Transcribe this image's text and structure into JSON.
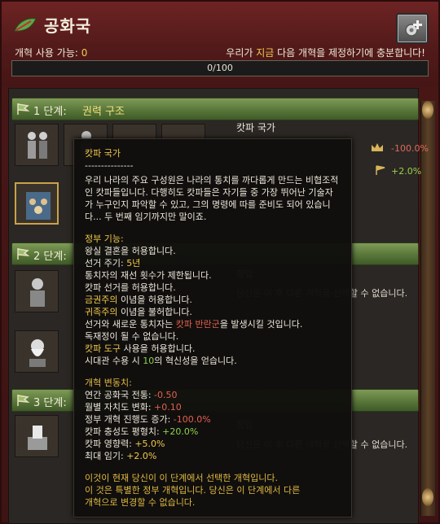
{
  "header": {
    "title": "공화국",
    "reform_available_label": "개혁 사용 가능: ",
    "reform_available_value": "0",
    "enough_msg_1": "우리가 ",
    "enough_msg_hl": "지금",
    "enough_msg_2": " 다음 개혁을 제정하기에 충분합니다!",
    "progress_text": "0/100",
    "progress_value": 0
  },
  "tiers": [
    {
      "num": "1 단계:",
      "name": "권력 구조"
    },
    {
      "num": "2 단계:",
      "name": ""
    },
    {
      "num": "3 단계:",
      "name": ""
    }
  ],
  "background": {
    "policy_name": "캇파 국가",
    "mod_red": "-100.0%",
    "mod_green": "+2.0%",
    "row2_title": "참입",
    "row2_text": "당신은 이 후 다른 개혁을 선택할 수 없습니다.",
    "row3_title": "참입",
    "row3_text": "당신은 이 후 다른 개혁을 선택할 수 없습니다."
  },
  "tooltip": {
    "title": "캇파 국가",
    "divider": "---------------",
    "description": "우리 나라의 주요 구성원은 나라의 통치를 까다롭게 만드는 비협조적인 캇파들입니다. 다행히도 캇파들은 자기들 중 가장 뛰어난 기술자가 누구인지 파악할 수 있고, 그의 명령에 따를 준비도 되어 있습니다... 두 번째 임기까지만 말이죠.",
    "gov_title": "정부 기능:",
    "gov_lines": {
      "l1": "왕실 결혼을 허용합니다.",
      "l2a": "선거 주기: ",
      "l2b": "5년",
      "l3": "통치자의 재선 횟수가 제한됩니다.",
      "l4": "캇파 선거를 허용합니다.",
      "l5a": "금권주의",
      "l5b": " 이념을 허용합니다.",
      "l6a": "귀족주의",
      "l6b": " 이념을 불허합니다.",
      "l7a": "선거와 새로운 통치자는 ",
      "l7b": "캇파 반란군",
      "l7c": "을 발생시킬 것입니다.",
      "l8": "독재정이 될 수 없습니다.",
      "l9a": "캇파 도구",
      "l9b": " 사용을 허용합니다.",
      "l10a": "시대관 수용 시 ",
      "l10b": "10",
      "l10c": "의 혁신성을 얻습니다."
    },
    "mods_title": "개혁 변동치:",
    "mods": [
      {
        "label": "연간 공화국 전통: ",
        "value": "-0.50",
        "tone": "red"
      },
      {
        "label": "월별 자치도 변화: ",
        "value": "+0.10",
        "tone": "red"
      },
      {
        "label": "정부 개혁 진행도 증가: ",
        "value": "-100.0%",
        "tone": "red"
      },
      {
        "label": "캇파 충성도 평형치: ",
        "value": "+20.0%",
        "tone": "green"
      },
      {
        "label": "캇파 영향력: ",
        "value": "+5.0%",
        "tone": "yellow"
      },
      {
        "label": "최대 임기: ",
        "value": "+2.0%",
        "tone": "yellow"
      }
    ],
    "footer_1": "이것이 현재 당신이 이 단계에서 선택한 개혁입니다.",
    "footer_2": "이 것은 특별한 정부 개혁입니다. 당신은 이 단계에서 다른",
    "footer_3": "개혁으로 변경할 수 없습니다."
  },
  "icons": {
    "header": "leaf-icon",
    "button": "gear-plus-icon",
    "tier_flag": "flag-icon"
  },
  "colors": {
    "accent_yellow": "#f2c94c",
    "negative_red": "#e26050",
    "positive_green": "#8fd14f",
    "tier_green": "#5c7a3c"
  }
}
